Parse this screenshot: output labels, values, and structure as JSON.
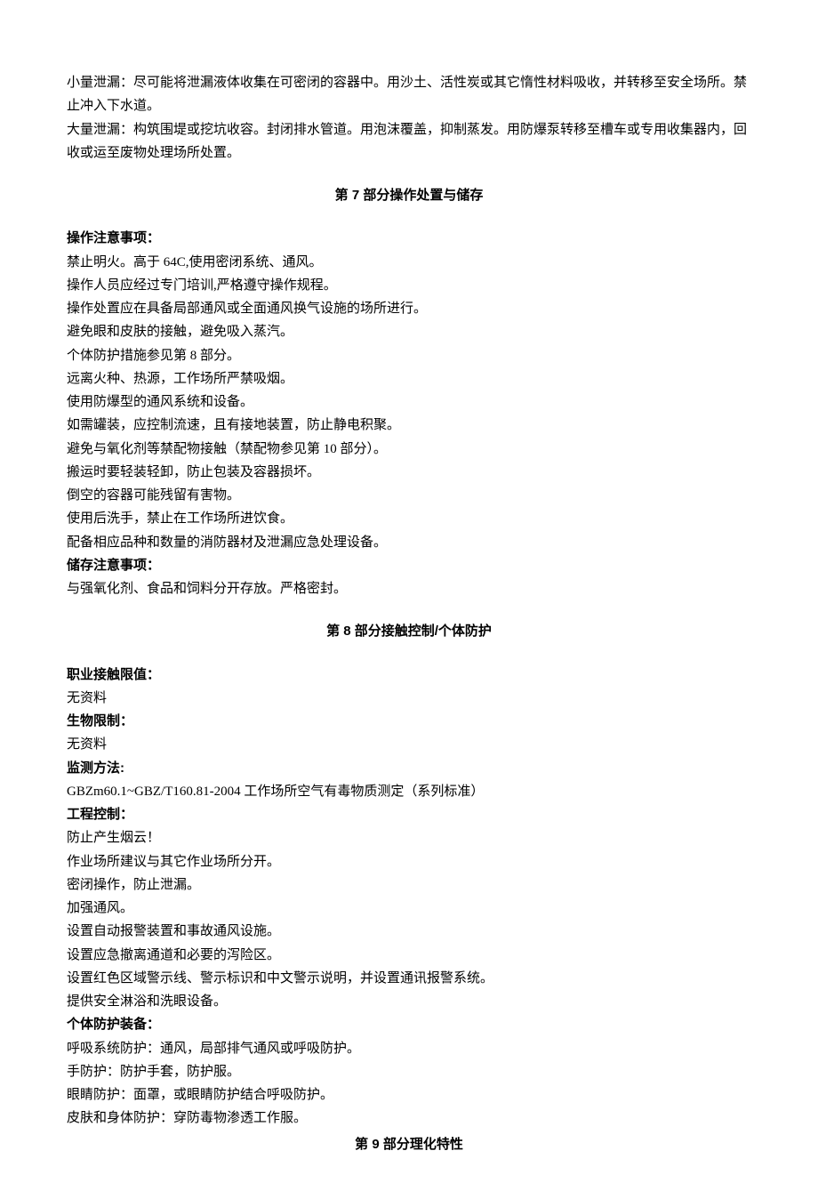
{
  "intro": {
    "p1": "小量泄漏：尽可能将泄漏液体收集在可密闭的容器中。用沙土、活性炭或其它惰性材料吸收，并转移至安全场所。禁止冲入下水道。",
    "p2": "大量泄漏：构筑围堤或挖坑收容。封闭排水管道。用泡沫覆盖，抑制蒸发。用防爆泵转移至槽车或专用收集器内，回收或运至废物处理场所处置。"
  },
  "section7": {
    "title": "第 7 部分操作处置与储存",
    "opLabel": "操作注意事项：",
    "op": {
      "l1": "禁止明火。高于 64C,使用密闭系统、通风。",
      "l2": "操作人员应经过专门培训,严格遵守操作规程。",
      "l3": "操作处置应在具备局部通风或全面通风换气设施的场所进行。",
      "l4": "避免眼和皮肤的接触，避免吸入蒸汽。",
      "l5": "个体防护措施参见第 8 部分。",
      "l6": "远离火种、热源，工作场所严禁吸烟。",
      "l7": "使用防爆型的通风系统和设备。",
      "l8": "如需罐装，应控制流速，且有接地装置，防止静电积聚。",
      "l9": "避免与氧化剂等禁配物接触（禁配物参见第 10 部分）。",
      "l10": "搬运时要轻装轻卸，防止包装及容器损坏。",
      "l11": "倒空的容器可能残留有害物。",
      "l12": "使用后洗手，禁止在工作场所进饮食。",
      "l13": "配备相应品种和数量的消防器材及泄漏应急处理设备。"
    },
    "storeLabel": "储存注意事项：",
    "storeText": "与强氧化剂、食品和饲料分开存放。严格密封。"
  },
  "section8": {
    "title": "第 8 部分接触控制/个体防护",
    "occLabel": "职业接触限值：",
    "occText": "无资料",
    "bioLabel": "生物限制：",
    "bioText": "无资料",
    "monLabel": "监测方法:",
    "monText": "GBZm60.1~GBZ/T160.81-2004 工作场所空气有毒物质测定（系列标准）",
    "engLabel": "工程控制：",
    "eng": {
      "l1": "防止产生烟云！",
      "l2": "作业场所建议与其它作业场所分开。",
      "l3": "密闭操作，防止泄漏。",
      "l4": "加强通风。",
      "l5": "设置自动报警装置和事故通风设施。",
      "l6": "设置应急撤离通道和必要的泻险区。",
      "l7": "设置红色区域警示线、警示标识和中文警示说明，并设置通讯报警系统。",
      "l8": "提供安全淋浴和洗眼设备。"
    },
    "ppeLabel": "个体防护装备：",
    "ppe": {
      "l1": "呼吸系统防护：通风，局部排气通风或呼吸防护。",
      "l2": "手防护：防护手套，防护服。",
      "l3": "眼睛防护：面罩，或眼睛防护结合呼吸防护。",
      "l4": "皮肤和身体防护：穿防毒物渗透工作服。"
    }
  },
  "section9": {
    "title": "第 9 部分理化特性"
  }
}
